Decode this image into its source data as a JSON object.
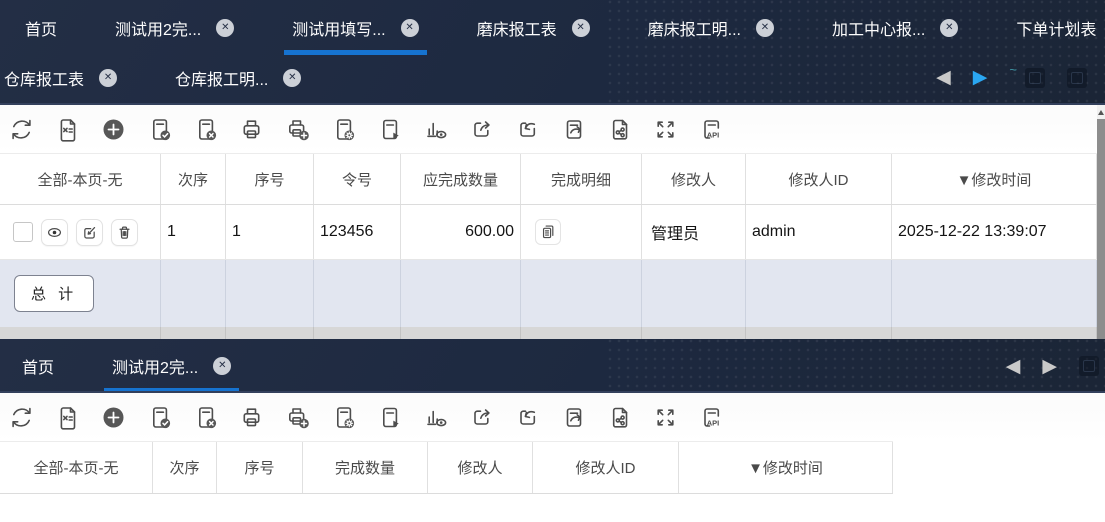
{
  "icons": {
    "close": "✕",
    "prev": "◀",
    "next": "▶",
    "sort_desc": "▼"
  },
  "colors": {
    "accent_blue": "#1673d0",
    "arrow_blue": "#2aa7f2",
    "dark_bar": "#1d2940",
    "total_row_bg": "#e2e6f0",
    "icon_gray": "#4d4d4d"
  },
  "toolbar": {
    "icons": [
      "refresh",
      "excel-export",
      "add",
      "form-check",
      "form-delete",
      "print",
      "print-add",
      "form-settings",
      "form-run",
      "chart-view",
      "export-arrow",
      "undo",
      "form-forward",
      "share",
      "fullscreen",
      "api"
    ]
  },
  "panel1": {
    "tabbar": {
      "row1": [
        {
          "label": "首页"
        },
        {
          "label": "测试用2完..."
        },
        {
          "label": "测试用填写...",
          "active": true
        },
        {
          "label": "磨床报工表"
        },
        {
          "label": "磨床报工明..."
        },
        {
          "label": "加工中心报..."
        },
        {
          "label": "下单计划表"
        }
      ],
      "row2": [
        {
          "label": "仓库报工表"
        },
        {
          "label": "仓库报工明..."
        }
      ]
    },
    "table": {
      "headers": [
        "全部-本页-无",
        "次序",
        "序号",
        "令号",
        "应完成数量",
        "完成明细",
        "修改人",
        "修改人ID",
        "▼修改时间"
      ],
      "row": {
        "cells": [
          "1",
          "1",
          "123456",
          "600.00",
          "管理员",
          "admin",
          "2025-12-22 13:39:07"
        ]
      },
      "total_label": "总 计"
    }
  },
  "panel2": {
    "tabbar": [
      {
        "label": "首页"
      },
      {
        "label": "测试用2完...",
        "active": true
      }
    ],
    "table": {
      "headers": [
        "全部-本页-无",
        "次序",
        "序号",
        "完成数量",
        "修改人",
        "修改人ID",
        "▼修改时间"
      ]
    }
  }
}
